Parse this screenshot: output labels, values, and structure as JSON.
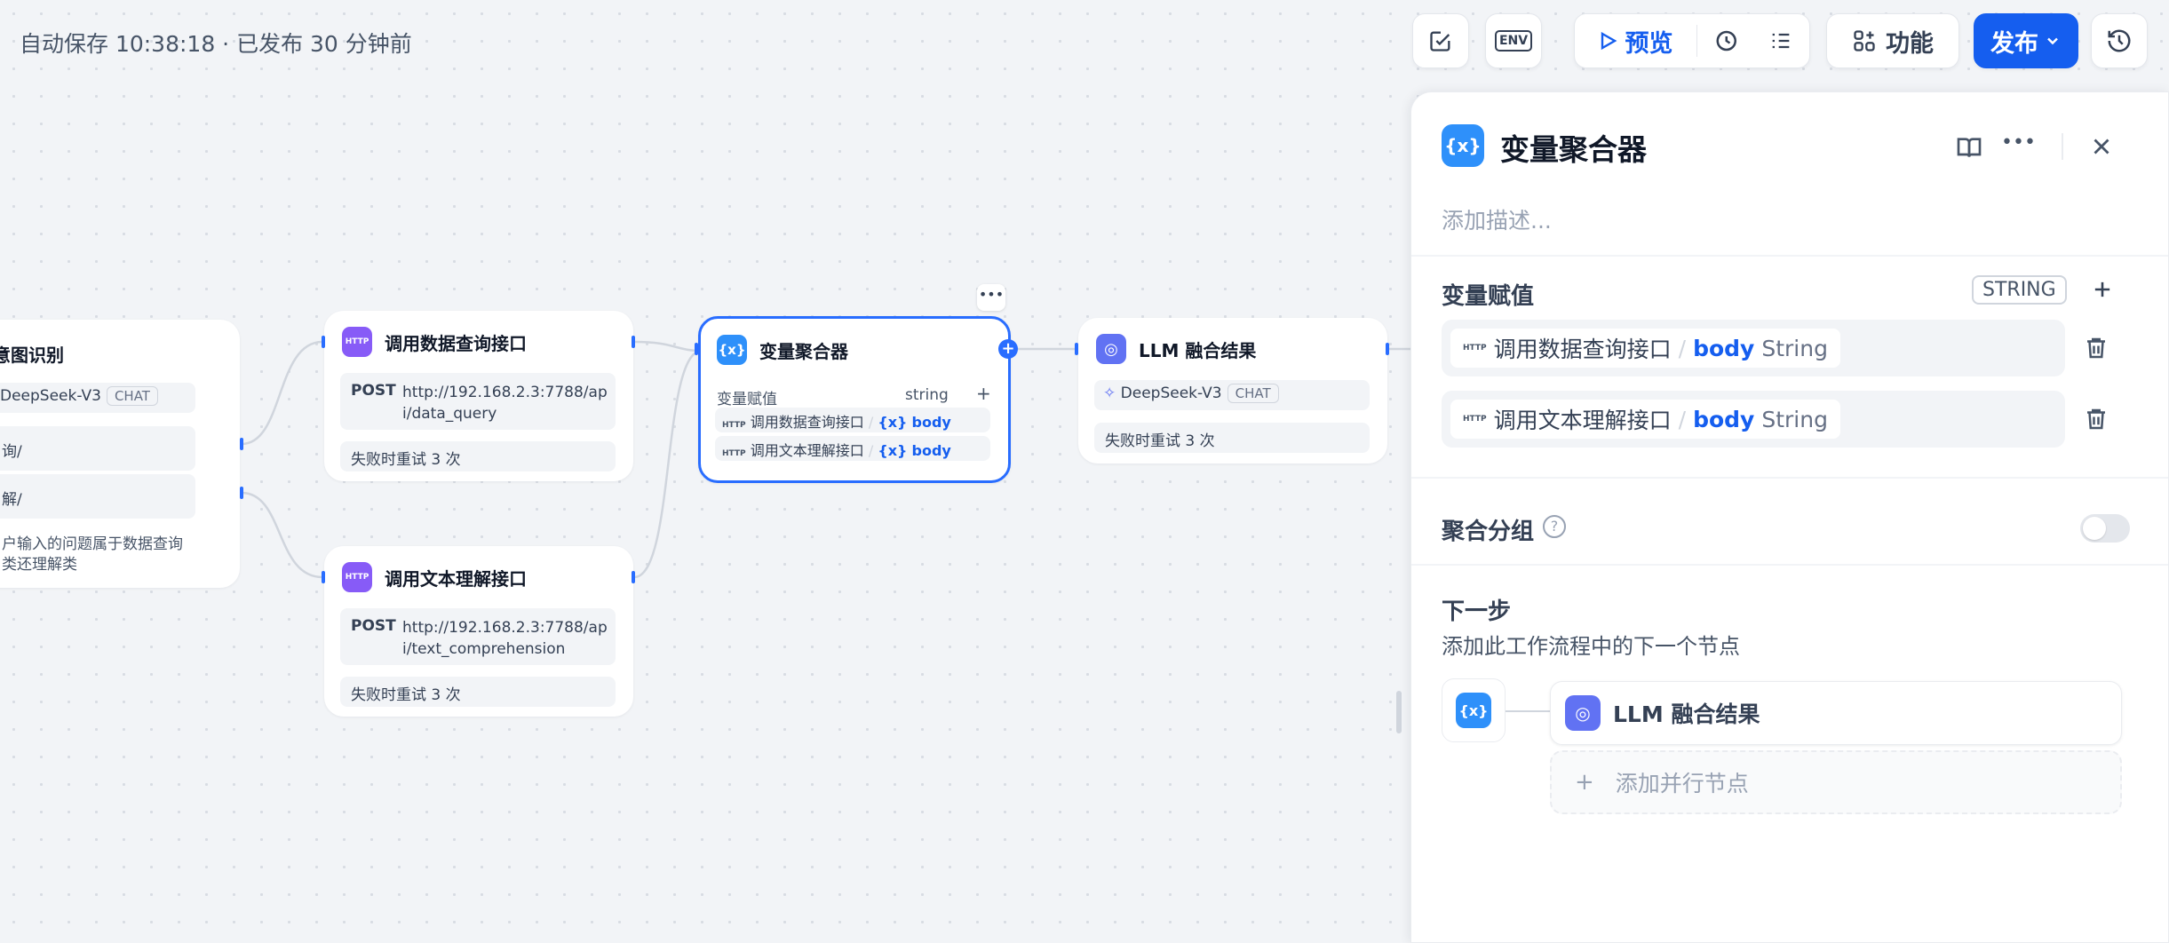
{
  "toolbar": {
    "status": "自动保存 10:38:18 · 已发布 30 分钟前",
    "env_label": "ENV",
    "preview_label": "预览",
    "feature_label": "功能",
    "publish_label": "发布"
  },
  "nodes": {
    "intent": {
      "title": "意图识别",
      "model": "DeepSeek-V3",
      "model_tag": "CHAT",
      "class1": "询/",
      "class2": "解/",
      "instruction": "户输入的问题属于数据查询类还理解类"
    },
    "http_query": {
      "title": "调用数据查询接口",
      "method": "POST",
      "url": "http://192.168.2.3:7788/api/data_query",
      "retry": "失败时重试 3 次"
    },
    "http_text": {
      "title": "调用文本理解接口",
      "method": "POST",
      "url": "http://192.168.2.3:7788/api/text_comprehension",
      "retry": "失败时重试 3 次"
    },
    "aggregator": {
      "title": "变量聚合器",
      "section": "变量赋值",
      "type": "string",
      "rows": [
        {
          "source": "调用数据查询接口",
          "var": "body"
        },
        {
          "source": "调用文本理解接口",
          "var": "body"
        }
      ]
    },
    "llm": {
      "title": "LLM 融合结果",
      "model": "DeepSeek-V3",
      "model_tag": "CHAT",
      "retry": "失败时重试 3 次"
    }
  },
  "panel": {
    "title": "变量聚合器",
    "description_placeholder": "添加描述...",
    "assign_title": "变量赋值",
    "assign_type": "STRING",
    "vars": [
      {
        "source": "调用数据查询接口",
        "var": "body",
        "type": "String"
      },
      {
        "source": "调用文本理解接口",
        "var": "body",
        "type": "String"
      }
    ],
    "group_title": "聚合分组",
    "group_enabled": false,
    "next_title": "下一步",
    "next_desc": "添加此工作流程中的下一个节点",
    "next_node": "LLM 融合结果",
    "add_parallel": "添加并行节点"
  },
  "colors": {
    "accent": "#155eef",
    "http_icon": "#875bf7",
    "var_icon": "#2e90fa",
    "llm_icon": "#6172f3"
  }
}
